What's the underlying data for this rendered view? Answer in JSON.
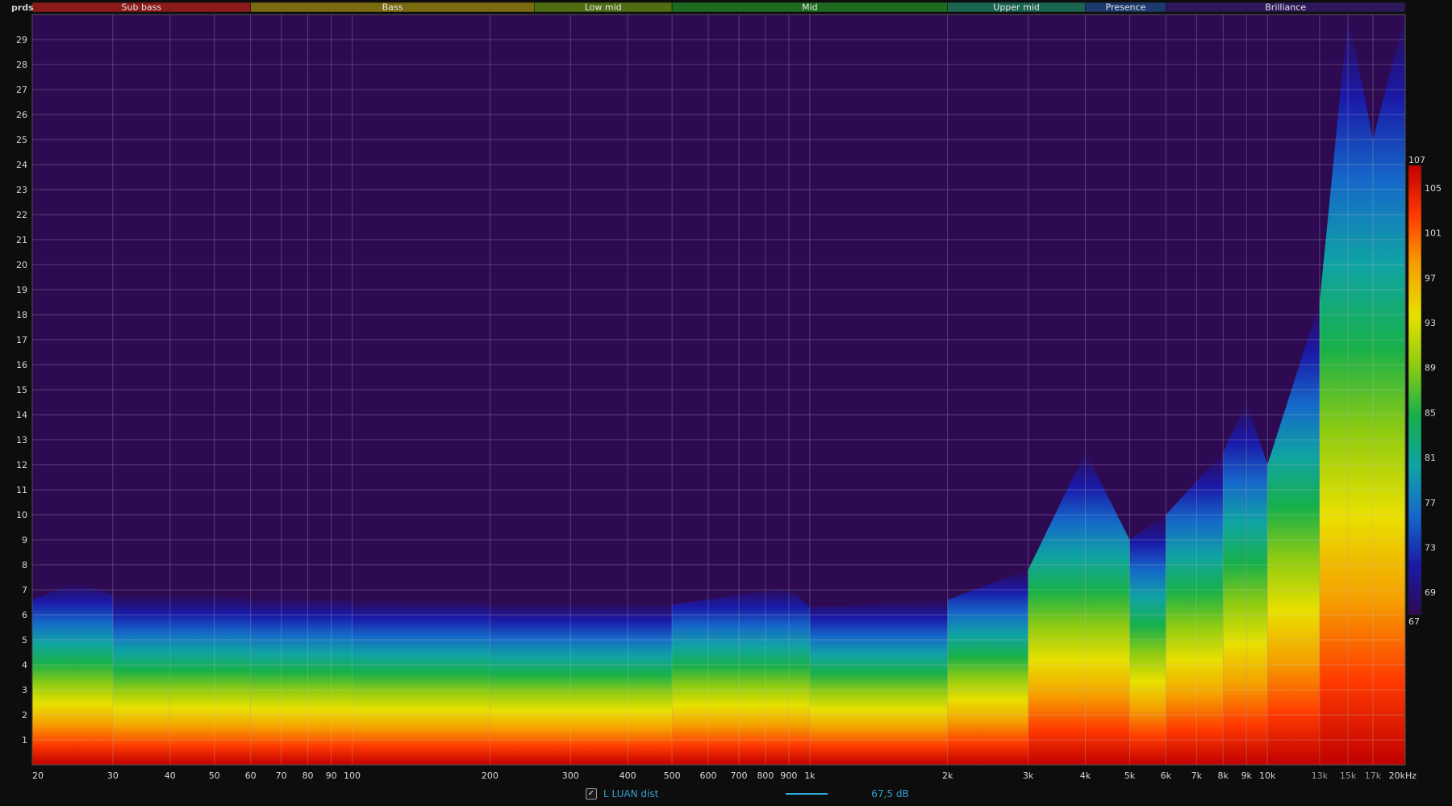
{
  "chart_data": {
    "type": "heatmap",
    "title": "",
    "xlabel": "",
    "ylabel": "prds",
    "x_scale": "log",
    "xlim": [
      20,
      20000
    ],
    "ylim": [
      0,
      30
    ],
    "x_ticks": [
      {
        "value": 20,
        "label": "20"
      },
      {
        "value": 30,
        "label": "30"
      },
      {
        "value": 40,
        "label": "40"
      },
      {
        "value": 50,
        "label": "50"
      },
      {
        "value": 60,
        "label": "60"
      },
      {
        "value": 70,
        "label": "70"
      },
      {
        "value": 80,
        "label": "80"
      },
      {
        "value": 90,
        "label": "90"
      },
      {
        "value": 100,
        "label": "100"
      },
      {
        "value": 200,
        "label": "200"
      },
      {
        "value": 300,
        "label": "300"
      },
      {
        "value": 400,
        "label": "400"
      },
      {
        "value": 500,
        "label": "500"
      },
      {
        "value": 600,
        "label": "600"
      },
      {
        "value": 700,
        "label": "700"
      },
      {
        "value": 800,
        "label": "800"
      },
      {
        "value": 900,
        "label": "900"
      },
      {
        "value": 1000,
        "label": "1k"
      },
      {
        "value": 2000,
        "label": "2k"
      },
      {
        "value": 3000,
        "label": "3k"
      },
      {
        "value": 4000,
        "label": "4k"
      },
      {
        "value": 5000,
        "label": "5k"
      },
      {
        "value": 6000,
        "label": "6k"
      },
      {
        "value": 7000,
        "label": "7k"
      },
      {
        "value": 8000,
        "label": "8k"
      },
      {
        "value": 9000,
        "label": "9k"
      },
      {
        "value": 10000,
        "label": "10k"
      },
      {
        "value": 13000,
        "label": "13k"
      },
      {
        "value": 15000,
        "label": "15k"
      },
      {
        "value": 17000,
        "label": "17k"
      },
      {
        "value": 20000,
        "label": "20kHz"
      }
    ],
    "y_ticks": [
      1,
      2,
      3,
      4,
      5,
      6,
      7,
      8,
      9,
      10,
      11,
      12,
      13,
      14,
      15,
      16,
      17,
      18,
      19,
      20,
      21,
      22,
      23,
      24,
      25,
      26,
      27,
      28,
      29
    ],
    "bands": [
      {
        "name": "Sub bass",
        "from": 20,
        "to": 60,
        "color": "#8b1a1a"
      },
      {
        "name": "Bass",
        "from": 60,
        "to": 250,
        "color": "#7a6a10"
      },
      {
        "name": "Low mid",
        "from": 250,
        "to": 500,
        "color": "#4f6d12"
      },
      {
        "name": "Mid",
        "from": 500,
        "to": 2000,
        "color": "#1e6b20"
      },
      {
        "name": "Upper mid",
        "from": 2000,
        "to": 4000,
        "color": "#1b6450"
      },
      {
        "name": "Presence",
        "from": 4000,
        "to": 6000,
        "color": "#1d3a6e"
      },
      {
        "name": "Brilliance",
        "from": 6000,
        "to": 20000,
        "color": "#2c1858"
      }
    ],
    "color_scale": {
      "min": 67,
      "max": 107,
      "ticks": [
        107,
        105,
        101,
        97,
        93,
        89,
        85,
        81,
        77,
        73,
        69,
        67
      ],
      "colors": [
        "#2e0a52",
        "#1a1aa8",
        "#1569c9",
        "#10a3a3",
        "#18b04a",
        "#8fcb12",
        "#e8e000",
        "#f5a000",
        "#ff3a00",
        "#c00000"
      ]
    },
    "grid": true,
    "decay_profile": [
      {
        "x": 20,
        "extent": 6.6
      },
      {
        "x": 25,
        "extent": 7.3
      },
      {
        "x": 30,
        "extent": 6.8
      },
      {
        "x": 40,
        "extent": 6.8
      },
      {
        "x": 60,
        "extent": 6.7
      },
      {
        "x": 100,
        "extent": 6.6
      },
      {
        "x": 200,
        "extent": 6.5
      },
      {
        "x": 500,
        "extent": 6.4
      },
      {
        "x": 900,
        "extent": 7.1
      },
      {
        "x": 1000,
        "extent": 6.3
      },
      {
        "x": 2000,
        "extent": 6.6
      },
      {
        "x": 3000,
        "extent": 7.8
      },
      {
        "x": 4000,
        "extent": 12.5
      },
      {
        "x": 5000,
        "extent": 9.0
      },
      {
        "x": 6000,
        "extent": 10.0
      },
      {
        "x": 8000,
        "extent": 12.5
      },
      {
        "x": 9000,
        "extent": 14.5
      },
      {
        "x": 10000,
        "extent": 12.0
      },
      {
        "x": 13000,
        "extent": 18.5
      },
      {
        "x": 15000,
        "extent": 30.0
      },
      {
        "x": 17000,
        "extent": 25.0
      },
      {
        "x": 20000,
        "extent": 30.0
      }
    ]
  },
  "legend": {
    "checked": true,
    "checkmark": "✓",
    "label": "L LUAN dist",
    "value": "67,5 dB"
  }
}
